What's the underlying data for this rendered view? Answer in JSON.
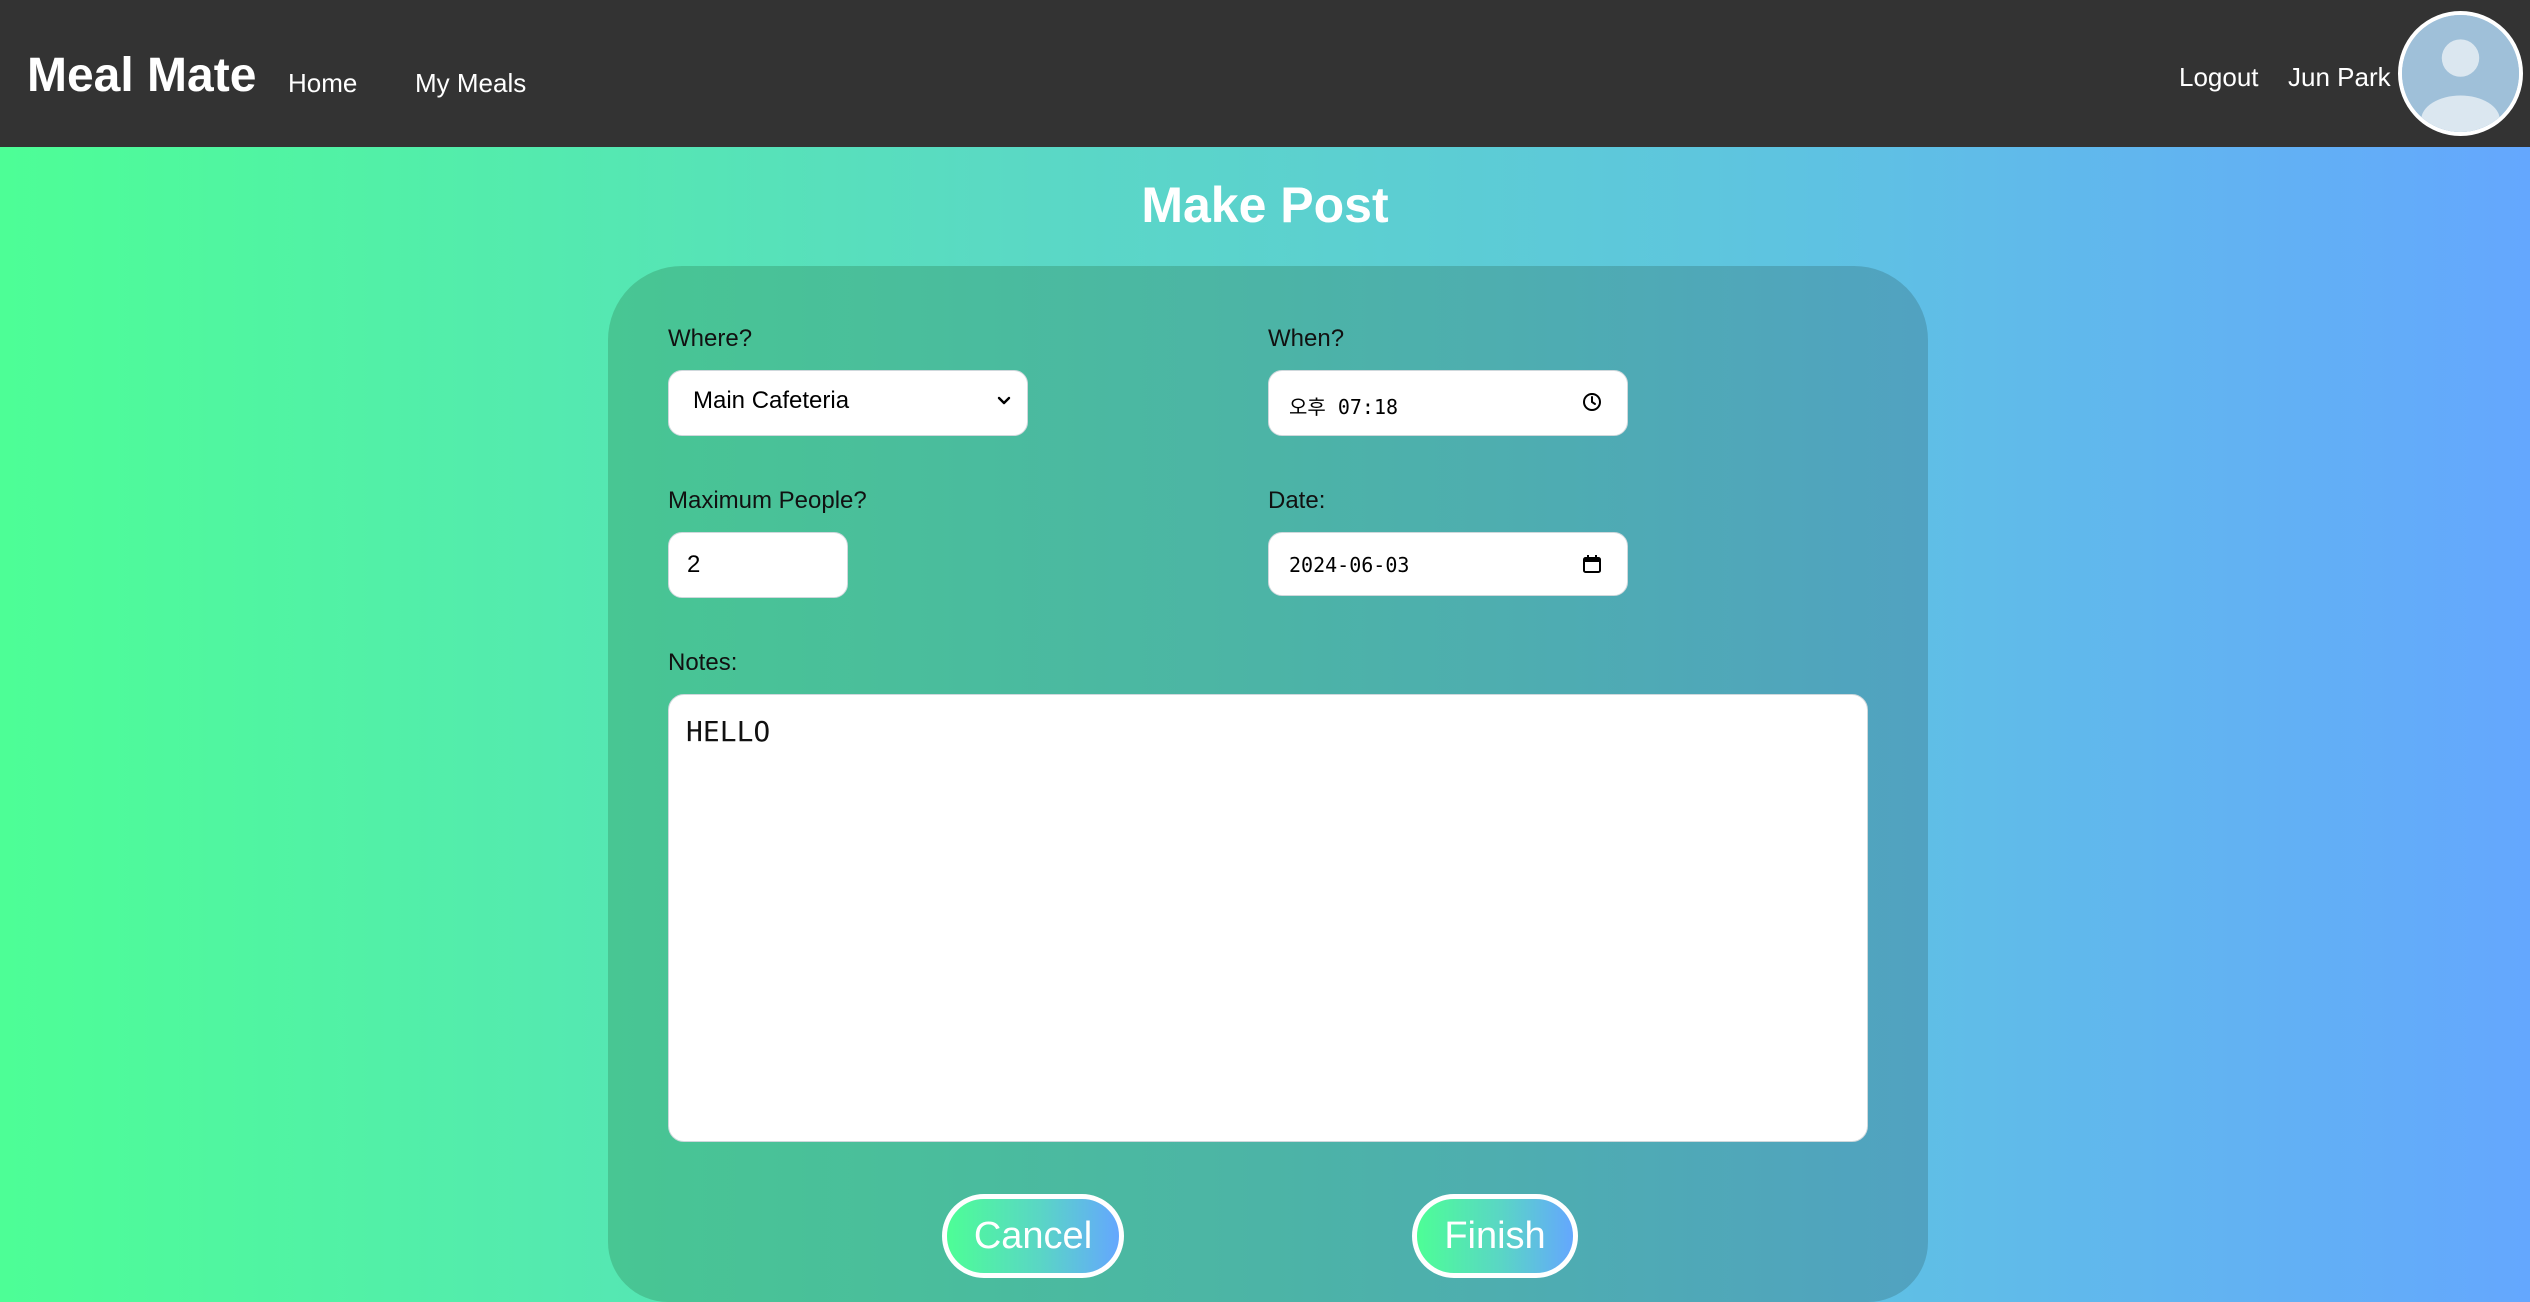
{
  "nav": {
    "brand": "Meal Mate",
    "links": [
      "Home",
      "My Meals"
    ],
    "logout": "Logout",
    "user_name": "Jun Park",
    "avatar_icon": "user-avatar-icon"
  },
  "page": {
    "title": "Make Post"
  },
  "form": {
    "where": {
      "label": "Where?",
      "value": "Main Cafeteria"
    },
    "when": {
      "label": "When?",
      "value": "오후 07:18"
    },
    "max_people": {
      "label": "Maximum People?",
      "value": "2"
    },
    "date": {
      "label": "Date:",
      "value": "2024-06-03"
    },
    "notes": {
      "label": "Notes:",
      "value": "HELLO"
    }
  },
  "buttons": {
    "cancel": "Cancel",
    "finish": "Finish"
  },
  "colors": {
    "navbar": "#333333",
    "gradient_start": "#4dfe96",
    "gradient_end": "#64a7fe"
  }
}
